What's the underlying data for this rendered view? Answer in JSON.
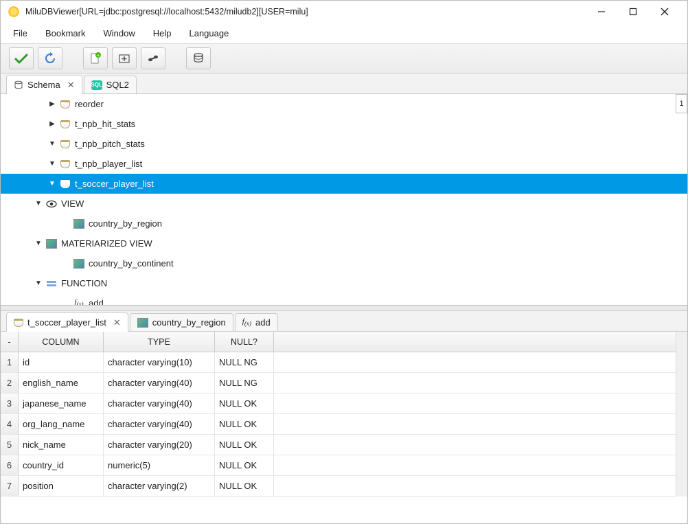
{
  "window": {
    "title": "MiluDBViewer[URL=jdbc:postgresql://localhost:5432/miludb2][USER=milu]"
  },
  "menubar": [
    "File",
    "Bookmark",
    "Window",
    "Help",
    "Language"
  ],
  "upper_tabs": [
    {
      "label": "Schema",
      "closable": true,
      "active": true
    },
    {
      "label": "SQL2",
      "closable": false,
      "active": false
    }
  ],
  "tree": [
    {
      "indent": 54,
      "arrow": "right",
      "icon": "table",
      "label": "reorder",
      "selected": false
    },
    {
      "indent": 54,
      "arrow": "right",
      "icon": "table",
      "label": "t_npb_hit_stats",
      "selected": false
    },
    {
      "indent": 54,
      "arrow": "down",
      "icon": "table",
      "label": "t_npb_pitch_stats",
      "selected": false
    },
    {
      "indent": 54,
      "arrow": "down",
      "icon": "table",
      "label": "t_npb_player_list",
      "selected": false
    },
    {
      "indent": 54,
      "arrow": "down",
      "icon": "table",
      "label": "t_soccer_player_list",
      "selected": true
    },
    {
      "indent": 34,
      "arrow": "down",
      "icon": "eye",
      "label": "VIEW",
      "selected": false
    },
    {
      "indent": 74,
      "arrow": "",
      "icon": "pic",
      "label": "country_by_region",
      "selected": false
    },
    {
      "indent": 34,
      "arrow": "down",
      "icon": "pic2",
      "label": "MATERIARIZED VIEW",
      "selected": false
    },
    {
      "indent": 74,
      "arrow": "",
      "icon": "pic",
      "label": "country_by_continent",
      "selected": false
    },
    {
      "indent": 34,
      "arrow": "down",
      "icon": "func",
      "label": "FUNCTION",
      "selected": false
    },
    {
      "indent": 74,
      "arrow": "",
      "icon": "fx",
      "label": "add",
      "selected": false
    }
  ],
  "tree_scroll_badge": "1",
  "lower_tabs": [
    {
      "icon": "table",
      "label": "t_soccer_player_list",
      "closable": true,
      "active": true
    },
    {
      "icon": "pic",
      "label": "country_by_region",
      "closable": false,
      "active": false
    },
    {
      "icon": "fx",
      "label": "add",
      "closable": false,
      "active": false
    }
  ],
  "grid": {
    "headers": [
      "-",
      "COLUMN",
      "TYPE",
      "NULL?"
    ],
    "rows": [
      {
        "n": "1",
        "column": "id",
        "type": "character varying(10)",
        "null": "NULL NG"
      },
      {
        "n": "2",
        "column": "english_name",
        "type": "character varying(40)",
        "null": "NULL NG"
      },
      {
        "n": "3",
        "column": "japanese_name",
        "type": "character varying(40)",
        "null": "NULL OK"
      },
      {
        "n": "4",
        "column": "org_lang_name",
        "type": "character varying(40)",
        "null": "NULL OK"
      },
      {
        "n": "5",
        "column": "nick_name",
        "type": "character varying(20)",
        "null": "NULL OK"
      },
      {
        "n": "6",
        "column": "country_id",
        "type": "numeric(5)",
        "null": "NULL OK"
      },
      {
        "n": "7",
        "column": "position",
        "type": "character varying(2)",
        "null": "NULL OK"
      }
    ]
  }
}
